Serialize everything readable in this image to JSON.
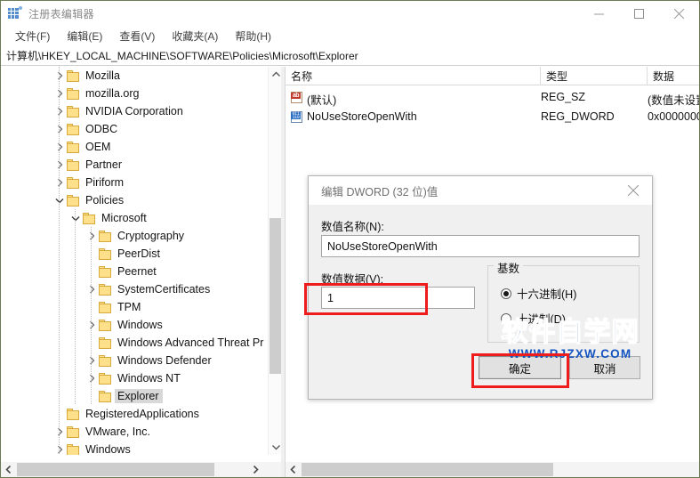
{
  "window": {
    "title": "注册表编辑器",
    "icon": "registry-editor-icon",
    "minimize": "—",
    "maximize": "▢",
    "close": "✕"
  },
  "menubar": {
    "items": [
      {
        "label": "文件(F)"
      },
      {
        "label": "编辑(E)"
      },
      {
        "label": "查看(V)"
      },
      {
        "label": "收藏夹(A)"
      },
      {
        "label": "帮助(H)"
      }
    ]
  },
  "address": {
    "path": "计算机\\HKEY_LOCAL_MACHINE\\SOFTWARE\\Policies\\Microsoft\\Explorer"
  },
  "tree": {
    "nodes": [
      {
        "label": "Mozilla",
        "depth": 1,
        "twist": "collapsed",
        "selected": false
      },
      {
        "label": "mozilla.org",
        "depth": 1,
        "twist": "collapsed",
        "selected": false
      },
      {
        "label": "NVIDIA Corporation",
        "depth": 1,
        "twist": "collapsed",
        "selected": false
      },
      {
        "label": "ODBC",
        "depth": 1,
        "twist": "collapsed",
        "selected": false
      },
      {
        "label": "OEM",
        "depth": 1,
        "twist": "collapsed",
        "selected": false
      },
      {
        "label": "Partner",
        "depth": 1,
        "twist": "collapsed",
        "selected": false
      },
      {
        "label": "Piriform",
        "depth": 1,
        "twist": "collapsed",
        "selected": false
      },
      {
        "label": "Policies",
        "depth": 1,
        "twist": "expanded",
        "selected": false
      },
      {
        "label": "Microsoft",
        "depth": 2,
        "twist": "expanded",
        "selected": false
      },
      {
        "label": "Cryptography",
        "depth": 3,
        "twist": "collapsed",
        "selected": false
      },
      {
        "label": "PeerDist",
        "depth": 3,
        "twist": "none",
        "selected": false
      },
      {
        "label": "Peernet",
        "depth": 3,
        "twist": "none",
        "selected": false
      },
      {
        "label": "SystemCertificates",
        "depth": 3,
        "twist": "collapsed",
        "selected": false
      },
      {
        "label": "TPM",
        "depth": 3,
        "twist": "none",
        "selected": false
      },
      {
        "label": "Windows",
        "depth": 3,
        "twist": "collapsed",
        "selected": false
      },
      {
        "label": "Windows Advanced Threat Pr",
        "depth": 3,
        "twist": "none",
        "selected": false
      },
      {
        "label": "Windows Defender",
        "depth": 3,
        "twist": "collapsed",
        "selected": false
      },
      {
        "label": "Windows NT",
        "depth": 3,
        "twist": "collapsed",
        "selected": false
      },
      {
        "label": "Explorer",
        "depth": 3,
        "twist": "none",
        "selected": true
      },
      {
        "label": "RegisteredApplications",
        "depth": 1,
        "twist": "none",
        "selected": false
      },
      {
        "label": "VMware, Inc.",
        "depth": 1,
        "twist": "collapsed",
        "selected": false
      },
      {
        "label": "Windows",
        "depth": 1,
        "twist": "collapsed",
        "selected": false
      }
    ]
  },
  "list": {
    "columns": [
      {
        "label": "名称"
      },
      {
        "label": "类型"
      },
      {
        "label": "数据"
      }
    ],
    "rows": [
      {
        "icon": "string-value-icon",
        "name": "(默认)",
        "type": "REG_SZ",
        "data": "(数值未设置"
      },
      {
        "icon": "dword-value-icon",
        "name": "NoUseStoreOpenWith",
        "type": "REG_DWORD",
        "data": "0x0000000"
      }
    ]
  },
  "dialog": {
    "title": "编辑 DWORD (32 位)值",
    "close_icon": "close-icon",
    "value_name_label": "数值名称(N):",
    "value_name": "NoUseStoreOpenWith",
    "value_data_label": "数值数据(V):",
    "value_data": "1",
    "base_group_label": "基数",
    "radios": [
      {
        "label": "十六进制(H)",
        "selected": true
      },
      {
        "label": "十进制(D)",
        "selected": false
      }
    ],
    "ok_label": "确定",
    "cancel_label": "取消"
  },
  "watermark": {
    "main": "软件自学网",
    "sub": "WWW.RJZXW.COM",
    "color": "#1554c0"
  },
  "highlight": {
    "color": "#ee1c1c"
  },
  "scrollbars": {
    "left_up_arrow": "▲",
    "left_down_arrow": "▼",
    "left_back_arrow": "◀",
    "left_fwd_arrow": "▶",
    "right_back_arrow": "◀"
  }
}
